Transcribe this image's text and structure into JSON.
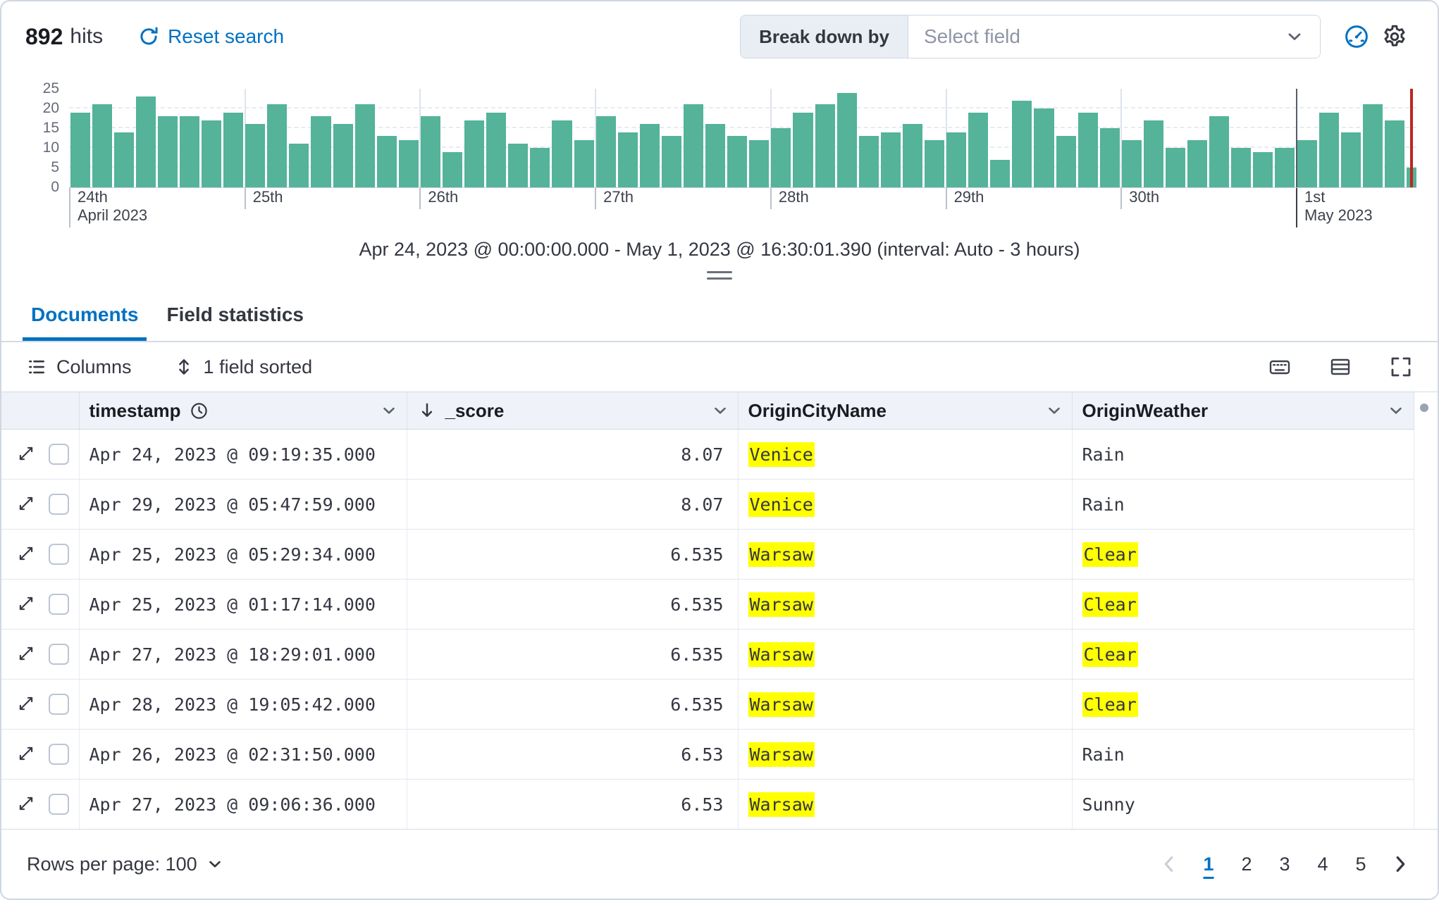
{
  "colors": {
    "accent": "#0071c2",
    "bar": "#54b399",
    "highlight": "#ffff00",
    "marker": "#bd271e"
  },
  "header": {
    "hits_count": "892",
    "hits_label": "hits",
    "reset_search": "Reset search",
    "break_down_by_label": "Break down by",
    "select_field_placeholder": "Select field"
  },
  "icons": {
    "reset_search": "refresh",
    "breakdown_chevron": "chevron-down",
    "edit_visualization": "gauge",
    "chart_options": "gear",
    "columns": "list",
    "sorted": "sort-arrows",
    "keyboard": "keyboard",
    "display_options": "table",
    "fullscreen": "fullscreen",
    "timestamp_clock": "clock",
    "score_sort": "arrow-down",
    "header_chevron": "chevron-down",
    "expand_row": "expand",
    "pagination_prev": "chevron-left",
    "pagination_next": "chevron-right"
  },
  "chart": {
    "caption": "Apr 24, 2023 @ 00:00:00.000 - May 1, 2023 @ 16:30:01.390 (interval: Auto - 3 hours)"
  },
  "chart_data": {
    "type": "bar",
    "title": "",
    "xlabel": "",
    "ylabel": "",
    "ylim": [
      0,
      25
    ],
    "y_ticks": [
      0,
      5,
      10,
      15,
      20,
      25
    ],
    "total_hours": 184.5,
    "interval_hours": 3,
    "grid": true,
    "x_ticks": [
      {
        "label": "24th",
        "sublabel": "April 2023",
        "hour": 0
      },
      {
        "label": "25th",
        "hour": 24
      },
      {
        "label": "26th",
        "hour": 48
      },
      {
        "label": "27th",
        "hour": 72
      },
      {
        "label": "28th",
        "hour": 96
      },
      {
        "label": "29th",
        "hour": 120
      },
      {
        "label": "30th",
        "hour": 144
      },
      {
        "label": "1st",
        "sublabel": "May 2023",
        "hour": 168,
        "dark": true
      }
    ],
    "values": [
      19,
      21,
      14,
      23,
      18,
      18,
      17,
      19,
      16,
      21,
      11,
      18,
      16,
      21,
      13,
      12,
      18,
      9,
      17,
      19,
      11,
      10,
      17,
      12,
      18,
      14,
      16,
      13,
      21,
      16,
      13,
      12,
      15,
      19,
      21,
      24,
      13,
      14,
      16,
      12,
      14,
      19,
      7,
      22,
      20,
      13,
      19,
      15,
      12,
      17,
      10,
      12,
      18,
      10,
      9,
      10,
      12,
      19,
      14,
      21,
      17,
      5
    ]
  },
  "tabs": [
    {
      "label": "Documents",
      "active": true
    },
    {
      "label": "Field statistics",
      "active": false
    }
  ],
  "toolbar": {
    "columns_label": "Columns",
    "sorted_label": "1 field sorted"
  },
  "table": {
    "columns": [
      "timestamp",
      "_score",
      "OriginCityName",
      "OriginWeather"
    ],
    "rows": [
      {
        "timestamp": "Apr 24, 2023 @ 09:19:35.000",
        "score": "8.07",
        "city": "Venice",
        "city_highlight": true,
        "weather": "Rain",
        "weather_highlight": false
      },
      {
        "timestamp": "Apr 29, 2023 @ 05:47:59.000",
        "score": "8.07",
        "city": "Venice",
        "city_highlight": true,
        "weather": "Rain",
        "weather_highlight": false
      },
      {
        "timestamp": "Apr 25, 2023 @ 05:29:34.000",
        "score": "6.535",
        "city": "Warsaw",
        "city_highlight": true,
        "weather": "Clear",
        "weather_highlight": true
      },
      {
        "timestamp": "Apr 25, 2023 @ 01:17:14.000",
        "score": "6.535",
        "city": "Warsaw",
        "city_highlight": true,
        "weather": "Clear",
        "weather_highlight": true
      },
      {
        "timestamp": "Apr 27, 2023 @ 18:29:01.000",
        "score": "6.535",
        "city": "Warsaw",
        "city_highlight": true,
        "weather": "Clear",
        "weather_highlight": true
      },
      {
        "timestamp": "Apr 28, 2023 @ 19:05:42.000",
        "score": "6.535",
        "city": "Warsaw",
        "city_highlight": true,
        "weather": "Clear",
        "weather_highlight": true
      },
      {
        "timestamp": "Apr 26, 2023 @ 02:31:50.000",
        "score": "6.53",
        "city": "Warsaw",
        "city_highlight": true,
        "weather": "Rain",
        "weather_highlight": false
      },
      {
        "timestamp": "Apr 27, 2023 @ 09:06:36.000",
        "score": "6.53",
        "city": "Warsaw",
        "city_highlight": true,
        "weather": "Sunny",
        "weather_highlight": false
      }
    ]
  },
  "footer": {
    "rows_per_page_label": "Rows per page: 100",
    "pages": [
      "1",
      "2",
      "3",
      "4",
      "5"
    ],
    "active_page": "1"
  }
}
